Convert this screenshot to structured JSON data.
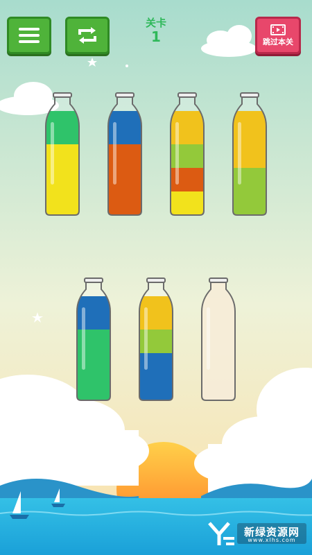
{
  "header": {
    "level_title": "关卡",
    "level_number": "1",
    "skip_label": "跳过本关"
  },
  "icons": {
    "menu": "hamburger-menu-icon",
    "restart": "restart-arrows-icon",
    "skip": "video-play-icon"
  },
  "colors": {
    "green": "#2fc36a",
    "yellow": "#f2e21c",
    "orange": "#dc5b12",
    "blue": "#1f6fb9",
    "lime": "#93c93a",
    "gold": "#f1c21c"
  },
  "bottles": [
    {
      "layers": [
        "green",
        "yellow",
        "yellow",
        "yellow"
      ]
    },
    {
      "layers": [
        "blue",
        "orange",
        "orange",
        "orange"
      ]
    },
    {
      "layers": [
        "gold",
        "lime",
        "orange",
        "yellow"
      ]
    },
    {
      "layers": [
        "gold",
        "gold",
        "lime",
        "lime"
      ]
    },
    {
      "layers": [
        "blue",
        "green",
        "green",
        "green"
      ]
    },
    {
      "layers": [
        "gold",
        "lime",
        "blue",
        "blue"
      ]
    },
    {
      "layers": []
    }
  ],
  "watermark": {
    "title": "新绿资源网",
    "subtitle": "www.xlhs.com"
  }
}
